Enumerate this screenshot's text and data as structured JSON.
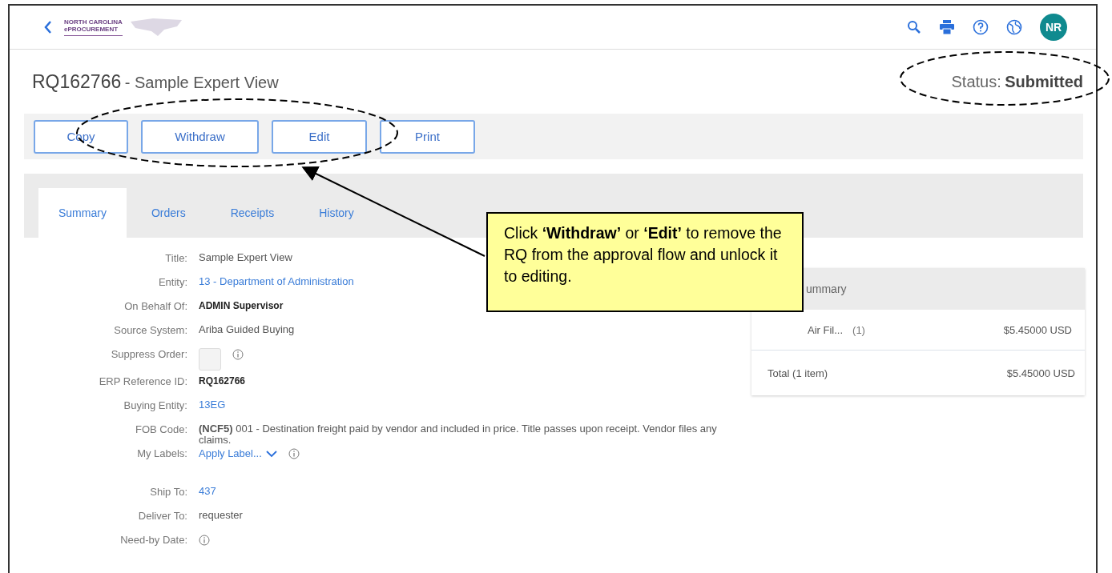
{
  "header": {
    "logo_lines": [
      "NORTH CAROLINA",
      "ePROCUREMENT"
    ],
    "avatar": "NR"
  },
  "title": {
    "id": "RQ162766",
    "name": " - Sample Expert View",
    "status_label": "Status:",
    "status": "Submitted"
  },
  "actions": [
    "Copy",
    "Withdraw",
    "Edit",
    "Print"
  ],
  "tabs": [
    {
      "label": "Summary",
      "selected": true
    },
    {
      "label": "Orders",
      "selected": false
    },
    {
      "label": "Receipts",
      "selected": false
    },
    {
      "label": "History",
      "selected": false
    }
  ],
  "field_groups": [
    [
      {
        "label": "Title:",
        "value": "Sample Expert View",
        "kind": "text"
      },
      {
        "label": "Entity:",
        "value": "13 - Department of Administration",
        "kind": "link"
      },
      {
        "label": "On Behalf Of:",
        "value": "ADMIN Supervisor",
        "kind": "strong"
      },
      {
        "label": "Source System:",
        "value": "Ariba Guided Buying",
        "kind": "text"
      },
      {
        "label": "Suppress Order:",
        "kind": "checkbox",
        "checked": false,
        "info": true
      },
      {
        "label": "ERP Reference ID:",
        "value": "RQ162766",
        "kind": "strong"
      },
      {
        "label": "Buying Entity:",
        "value": "13EG",
        "kind": "link"
      },
      {
        "label": "FOB Code:",
        "value": "**(NCF5)** 001 - Destination freight paid by vendor and included in price. Title passes upon receipt. Vendor files any claims.",
        "kind": "text"
      },
      {
        "label": "My Labels:",
        "value": "Apply Label...",
        "kind": "dropdown",
        "info": true
      }
    ],
    [
      {
        "label": "Ship To:",
        "value": "437",
        "kind": "link"
      },
      {
        "label": "Deliver To:",
        "value": "requester",
        "kind": "text"
      },
      {
        "label": "Need-by Date:",
        "kind": "empty",
        "info": true
      }
    ]
  ],
  "summary": {
    "heading": "ummary",
    "items": [
      {
        "name": "Air Fil...",
        "qty": "(1)",
        "amount": "$5.45000 USD"
      }
    ],
    "total_label": "Total (1 item)",
    "total": "$5.45000 USD"
  },
  "callout": {
    "text": "Click **‘Withdraw’** or **‘Edit’** to remove the RQ from the approval flow and unlock it to editing."
  }
}
